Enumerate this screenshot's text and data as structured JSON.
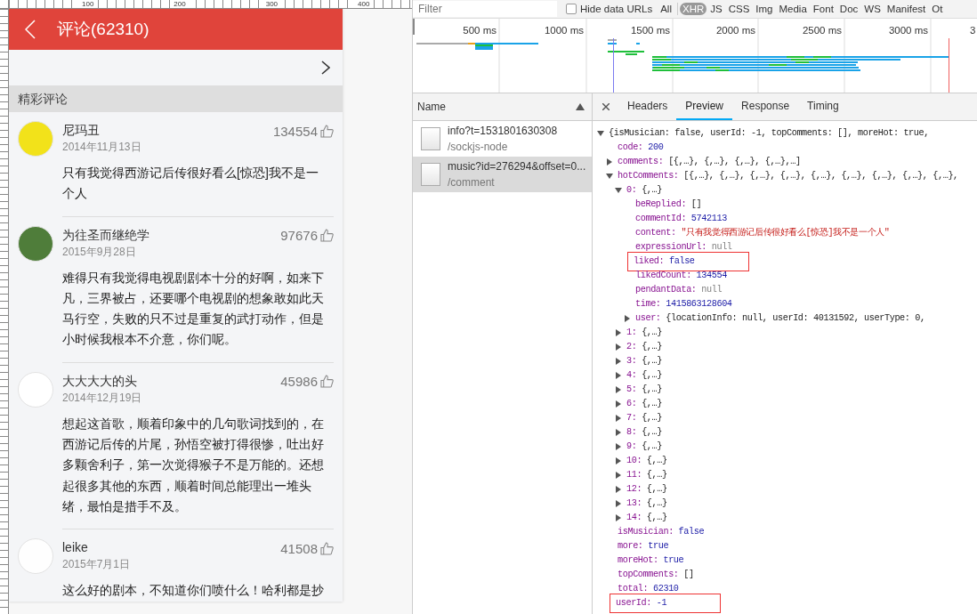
{
  "ruler": {
    "labels": [
      "100",
      "200",
      "300",
      "400"
    ]
  },
  "phone": {
    "title": "评论(62310)",
    "section": "精彩评论",
    "comments": [
      {
        "name": "尼玛丑",
        "date": "2014年11月13日",
        "likes": "134554",
        "color": "#f2e21a",
        "text": "只有我觉得西游记后传很好看么[惊恐]我不是一个人"
      },
      {
        "name": "为往圣而继绝学",
        "date": "2015年9月28日",
        "likes": "97676",
        "color": "#4f7d3a",
        "text": "难得只有我觉得电视剧剧本十分的好啊，如来下凡，三界被占，还要哪个电视剧的想象敢如此天马行空，失败的只不过是重复的武打动作，但是小时候我根本不介意，你们呢。"
      },
      {
        "name": "大大大大的头",
        "date": "2014年12月19日",
        "likes": "45986",
        "color": "#ffffff",
        "text": "想起这首歌，顺着印象中的几句歌词找到的，在西游记后传的片尾，孙悟空被打得很惨，吐出好多颗舍利子，第一次觉得猴子不是万能的。还想起很多其他的东西，顺着时间总能理出一堆头绪，最怕是措手不及。"
      },
      {
        "name": "leike",
        "date": "2015年7月1日",
        "likes": "41508",
        "color": "#fefefe",
        "text": "这么好的剧本，不知道你们喷什么！哈利都是抄"
      }
    ]
  },
  "devtools": {
    "filter": {
      "placeholder": "Filter"
    },
    "hide_data_urls": {
      "label": "Hide data URLs",
      "checked": false
    },
    "types": [
      {
        "label": "All",
        "selected": false
      },
      {
        "label": "XHR",
        "selected": true
      },
      {
        "label": "JS",
        "selected": false
      },
      {
        "label": "CSS",
        "selected": false
      },
      {
        "label": "Img",
        "selected": false
      },
      {
        "label": "Media",
        "selected": false
      },
      {
        "label": "Font",
        "selected": false
      },
      {
        "label": "Doc",
        "selected": false
      },
      {
        "label": "WS",
        "selected": false
      },
      {
        "label": "Manifest",
        "selected": false
      },
      {
        "label": "Ot",
        "selected": false
      }
    ],
    "timeline_ticks": [
      "500 ms",
      "1000 ms",
      "1500 ms",
      "2000 ms",
      "2500 ms",
      "3000 ms",
      "3"
    ],
    "name_header": "Name",
    "requests": [
      {
        "name": "info?t=1531801630308",
        "path": "/sockjs-node",
        "selected": false
      },
      {
        "name": "music?id=276294&offset=0...",
        "path": "/comment",
        "selected": true
      }
    ],
    "tabs": [
      {
        "label": "Headers",
        "selected": false
      },
      {
        "label": "Preview",
        "selected": true
      },
      {
        "label": "Response",
        "selected": false
      },
      {
        "label": "Timing",
        "selected": false
      }
    ],
    "tree": {
      "value": "{isMusician: false, userId: -1, topComments: [], moreHot: true,",
      "kind": "preview",
      "expanded": true,
      "boxed": false,
      "children": [
        {
          "key": "code:",
          "value": "200",
          "kind": "number",
          "boxed": false
        },
        {
          "key": "comments:",
          "value": "[{,…}, {,…}, {,…}, {,…},…]",
          "kind": "preview",
          "expanded": false,
          "boxed": false
        },
        {
          "key": "hotComments:",
          "value": "[{,…}, {,…}, {,…}, {,…}, {,…}, {,…}, {,…}, {,…}, {,…},",
          "kind": "preview",
          "expanded": true,
          "boxed": false,
          "children": [
            {
              "key": "0:",
              "value": "{,…}",
              "kind": "preview",
              "expanded": true,
              "boxed": false,
              "children": [
                {
                  "key": "beReplied:",
                  "value": "[]",
                  "kind": "preview",
                  "boxed": false
                },
                {
                  "key": "commentId:",
                  "value": "5742113",
                  "kind": "number",
                  "boxed": false
                },
                {
                  "key": "content:",
                  "value": "\"只有我觉得西游记后传很好看么[惊恐]我不是一个人\"",
                  "kind": "string",
                  "boxed": false
                },
                {
                  "key": "expressionUrl:",
                  "value": "null",
                  "kind": "null",
                  "boxed": false
                },
                {
                  "key": "liked:",
                  "value": "false",
                  "kind": "number",
                  "boxed": true
                },
                {
                  "key": "likedCount:",
                  "value": "134554",
                  "kind": "number",
                  "boxed": false
                },
                {
                  "key": "pendantData:",
                  "value": "null",
                  "kind": "null",
                  "boxed": false
                },
                {
                  "key": "time:",
                  "value": "1415863128604",
                  "kind": "number",
                  "boxed": false
                },
                {
                  "key": "user:",
                  "value": "{locationInfo: null, userId: 40131592, userType: 0,",
                  "kind": "preview",
                  "expanded": false,
                  "boxed": false
                }
              ]
            },
            {
              "key": "1:",
              "value": "{,…}",
              "kind": "preview",
              "expanded": false,
              "boxed": false
            },
            {
              "key": "2:",
              "value": "{,…}",
              "kind": "preview",
              "expanded": false,
              "boxed": false
            },
            {
              "key": "3:",
              "value": "{,…}",
              "kind": "preview",
              "expanded": false,
              "boxed": false
            },
            {
              "key": "4:",
              "value": "{,…}",
              "kind": "preview",
              "expanded": false,
              "boxed": false
            },
            {
              "key": "5:",
              "value": "{,…}",
              "kind": "preview",
              "expanded": false,
              "boxed": false
            },
            {
              "key": "6:",
              "value": "{,…}",
              "kind": "preview",
              "expanded": false,
              "boxed": false
            },
            {
              "key": "7:",
              "value": "{,…}",
              "kind": "preview",
              "expanded": false,
              "boxed": false
            },
            {
              "key": "8:",
              "value": "{,…}",
              "kind": "preview",
              "expanded": false,
              "boxed": false
            },
            {
              "key": "9:",
              "value": "{,…}",
              "kind": "preview",
              "expanded": false,
              "boxed": false
            },
            {
              "key": "10:",
              "value": "{,…}",
              "kind": "preview",
              "expanded": false,
              "boxed": false
            },
            {
              "key": "11:",
              "value": "{,…}",
              "kind": "preview",
              "expanded": false,
              "boxed": false
            },
            {
              "key": "12:",
              "value": "{,…}",
              "kind": "preview",
              "expanded": false,
              "boxed": false
            },
            {
              "key": "13:",
              "value": "{,…}",
              "kind": "preview",
              "expanded": false,
              "boxed": false
            },
            {
              "key": "14:",
              "value": "{,…}",
              "kind": "preview",
              "expanded": false,
              "boxed": false
            }
          ]
        },
        {
          "key": "isMusician:",
          "value": "false",
          "kind": "number",
          "boxed": false
        },
        {
          "key": "more:",
          "value": "true",
          "kind": "number",
          "boxed": false
        },
        {
          "key": "moreHot:",
          "value": "true",
          "kind": "number",
          "boxed": false
        },
        {
          "key": "topComments:",
          "value": "[]",
          "kind": "preview",
          "boxed": false
        },
        {
          "key": "total:",
          "value": "62310",
          "kind": "number",
          "boxed": false
        },
        {
          "key": "userId:",
          "value": "-1",
          "kind": "number",
          "boxed": true
        }
      ]
    }
  }
}
